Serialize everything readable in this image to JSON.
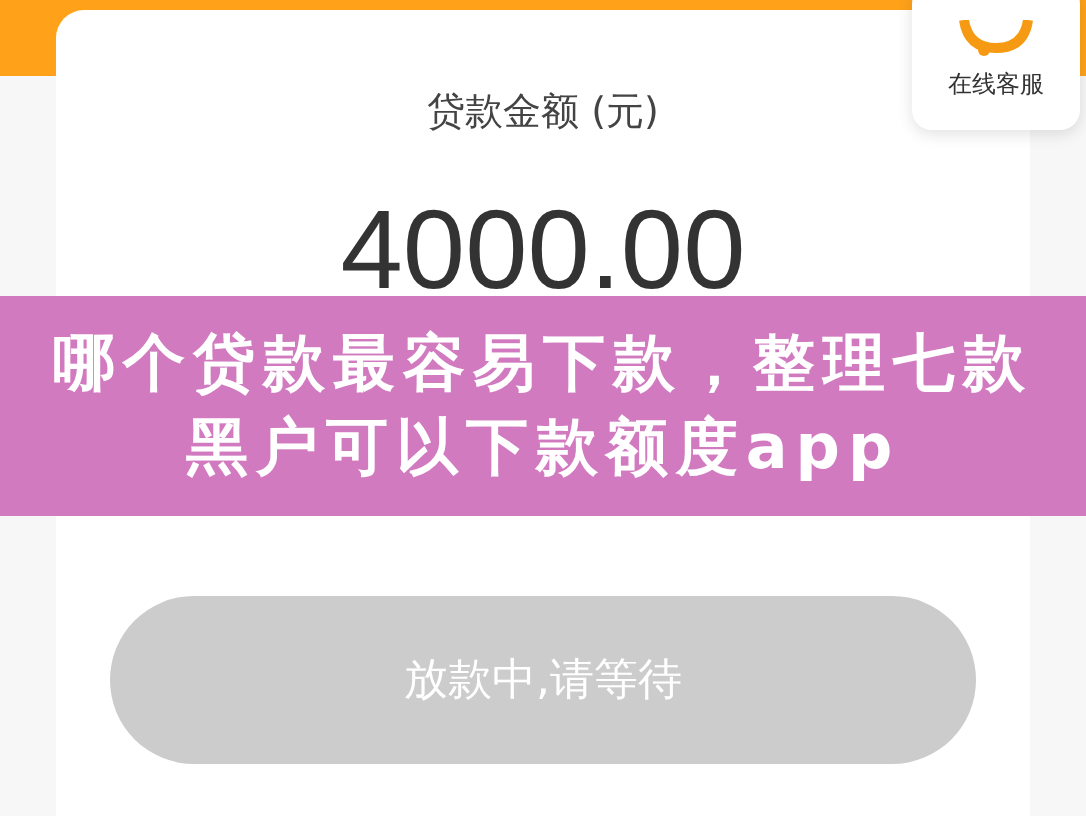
{
  "loan_card": {
    "label": "贷款金额 (元)",
    "amount": "4000.00",
    "button": {
      "label": "放款中,请等待",
      "disabled": true
    }
  },
  "support_widget": {
    "label": "在线客服"
  },
  "banner": {
    "title": "哪个贷款最容易下款，整理七款黑户可以下款额度app"
  }
}
